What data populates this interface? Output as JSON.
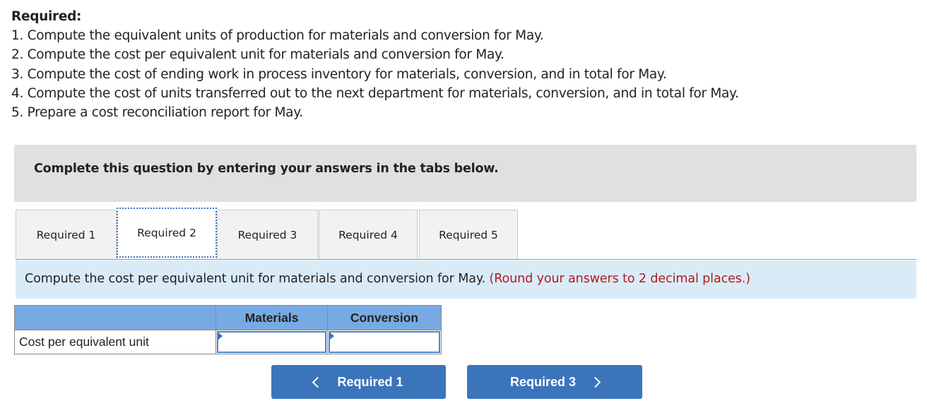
{
  "required": {
    "title": "Required:",
    "items": [
      "1. Compute the equivalent units of production for materials and conversion for May.",
      "2. Compute the cost per equivalent unit for materials and conversion for May.",
      "3. Compute the cost of ending work in process inventory for materials, conversion, and in total for May.",
      "4. Compute the cost of units transferred out to the next department for materials, conversion, and in total for May.",
      "5. Prepare a cost reconciliation report for May."
    ]
  },
  "instruction": "Complete this question by entering your answers in the tabs below.",
  "tabs": [
    {
      "label": "Required 1",
      "active": false
    },
    {
      "label": "Required 2",
      "active": true
    },
    {
      "label": "Required 3",
      "active": false
    },
    {
      "label": "Required 4",
      "active": false
    },
    {
      "label": "Required 5",
      "active": false
    }
  ],
  "prompt": {
    "text": "Compute the cost per equivalent unit for materials and conversion for May.",
    "note": "(Round your answers to 2 decimal places.)"
  },
  "table": {
    "headers": [
      "",
      "Materials",
      "Conversion"
    ],
    "rows": [
      {
        "label": "Cost per equivalent unit",
        "materials": "",
        "conversion": ""
      }
    ]
  },
  "navigation": {
    "prev_label": "Required 1",
    "next_label": "Required 3"
  },
  "colors": {
    "tab_focus": "#3a75c4",
    "header_bg": "#77aae3",
    "prompt_bg": "#daebf8",
    "note_red": "#b11c1c",
    "button_blue": "#3a75bc"
  }
}
